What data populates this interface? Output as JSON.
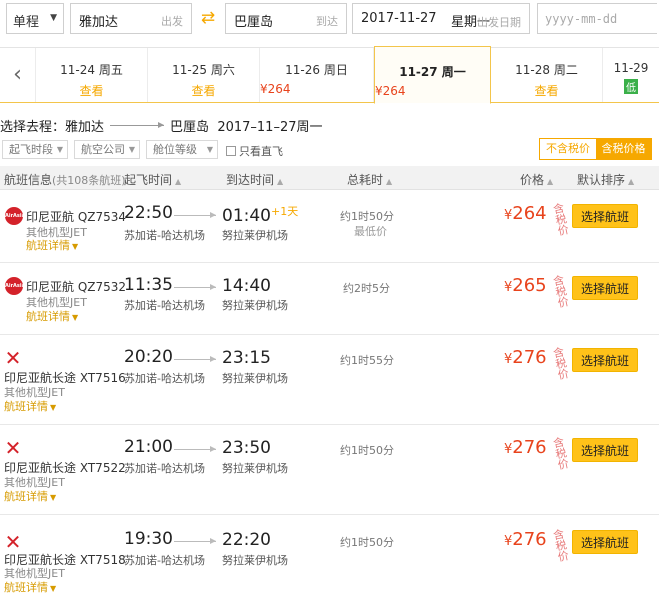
{
  "search": {
    "trip_type": "单程",
    "from_city": "雅加达",
    "from_tag": "出发",
    "to_city": "巴厘岛",
    "to_tag": "到达",
    "depart_date": "2017-11-27",
    "depart_weekday": "星期一",
    "depart_tag": "出发日期",
    "return_placeholder": "yyyy-mm-dd"
  },
  "date_tabs": [
    {
      "date": "11-24 周五",
      "price": "查看"
    },
    {
      "date": "11-25 周六",
      "price": "查看"
    },
    {
      "date": "11-26 周日",
      "price": "¥264"
    },
    {
      "date": "11-27 周一",
      "price": "¥264"
    },
    {
      "date": "11-28 周二",
      "price": "查看"
    },
    {
      "date": "11-29",
      "price": "低"
    }
  ],
  "selection": {
    "label": "选择去程：",
    "from": "雅加达",
    "to": "巴厘岛",
    "date": "2017–11–27周一"
  },
  "filters": {
    "depart_time": "起飞时段",
    "airline": "航空公司",
    "cabin": "舱位等级",
    "direct_only": "只看直飞",
    "tax_excluded": "不含税价",
    "tax_included": "含税价格"
  },
  "table_header": {
    "flight_info": "航班信息",
    "count": "(共108条航班)",
    "depart_time": "起飞时间",
    "arrive_time": "到达时间",
    "duration": "总耗时",
    "price": "价格",
    "sort": "默认排序"
  },
  "flights": [
    {
      "logo": "airasia-logo",
      "airline": "印尼亚航",
      "flight_no": "QZ7534",
      "model": "其他机型JET",
      "detail": "航班详情",
      "dep": "22:50",
      "dep_airport": "苏加诺-哈达机场",
      "arr": "01:40",
      "plus_day": "+1天",
      "arr_airport": "努拉莱伊机场",
      "duration": "约1时50分",
      "tag": "最低价",
      "currency": "¥",
      "price": "264",
      "tax_note": "含税价",
      "button": "选择航班"
    },
    {
      "logo": "airasia-logo",
      "airline": "印尼亚航",
      "flight_no": "QZ7532",
      "model": "其他机型JET",
      "detail": "航班详情",
      "dep": "11:35",
      "dep_airport": "苏加诺-哈达机场",
      "arr": "14:40",
      "plus_day": "",
      "arr_airport": "努拉莱伊机场",
      "duration": "约2时5分",
      "tag": "",
      "currency": "¥",
      "price": "265",
      "tax_note": "含税价",
      "button": "选择航班"
    },
    {
      "logo": "airasiax-logo",
      "airline": "印尼亚航长途",
      "flight_no": "XT7516",
      "model": "其他机型JET",
      "detail": "航班详情",
      "dep": "20:20",
      "dep_airport": "苏加诺-哈达机场",
      "arr": "23:15",
      "plus_day": "",
      "arr_airport": "努拉莱伊机场",
      "duration": "约1时55分",
      "tag": "",
      "currency": "¥",
      "price": "276",
      "tax_note": "含税价",
      "button": "选择航班"
    },
    {
      "logo": "airasiax-logo",
      "airline": "印尼亚航长途",
      "flight_no": "XT7522",
      "model": "其他机型JET",
      "detail": "航班详情",
      "dep": "21:00",
      "dep_airport": "苏加诺-哈达机场",
      "arr": "23:50",
      "plus_day": "",
      "arr_airport": "努拉莱伊机场",
      "duration": "约1时50分",
      "tag": "",
      "currency": "¥",
      "price": "276",
      "tax_note": "含税价",
      "button": "选择航班"
    },
    {
      "logo": "airasiax-logo",
      "airline": "印尼亚航长途",
      "flight_no": "XT7518",
      "model": "其他机型JET",
      "detail": "航班详情",
      "dep": "19:30",
      "dep_airport": "苏加诺-哈达机场",
      "arr": "22:20",
      "plus_day": "",
      "arr_airport": "努拉莱伊机场",
      "duration": "约1时50分",
      "tag": "",
      "currency": "¥",
      "price": "276",
      "tax_note": "含税价",
      "button": "选择航班"
    }
  ]
}
